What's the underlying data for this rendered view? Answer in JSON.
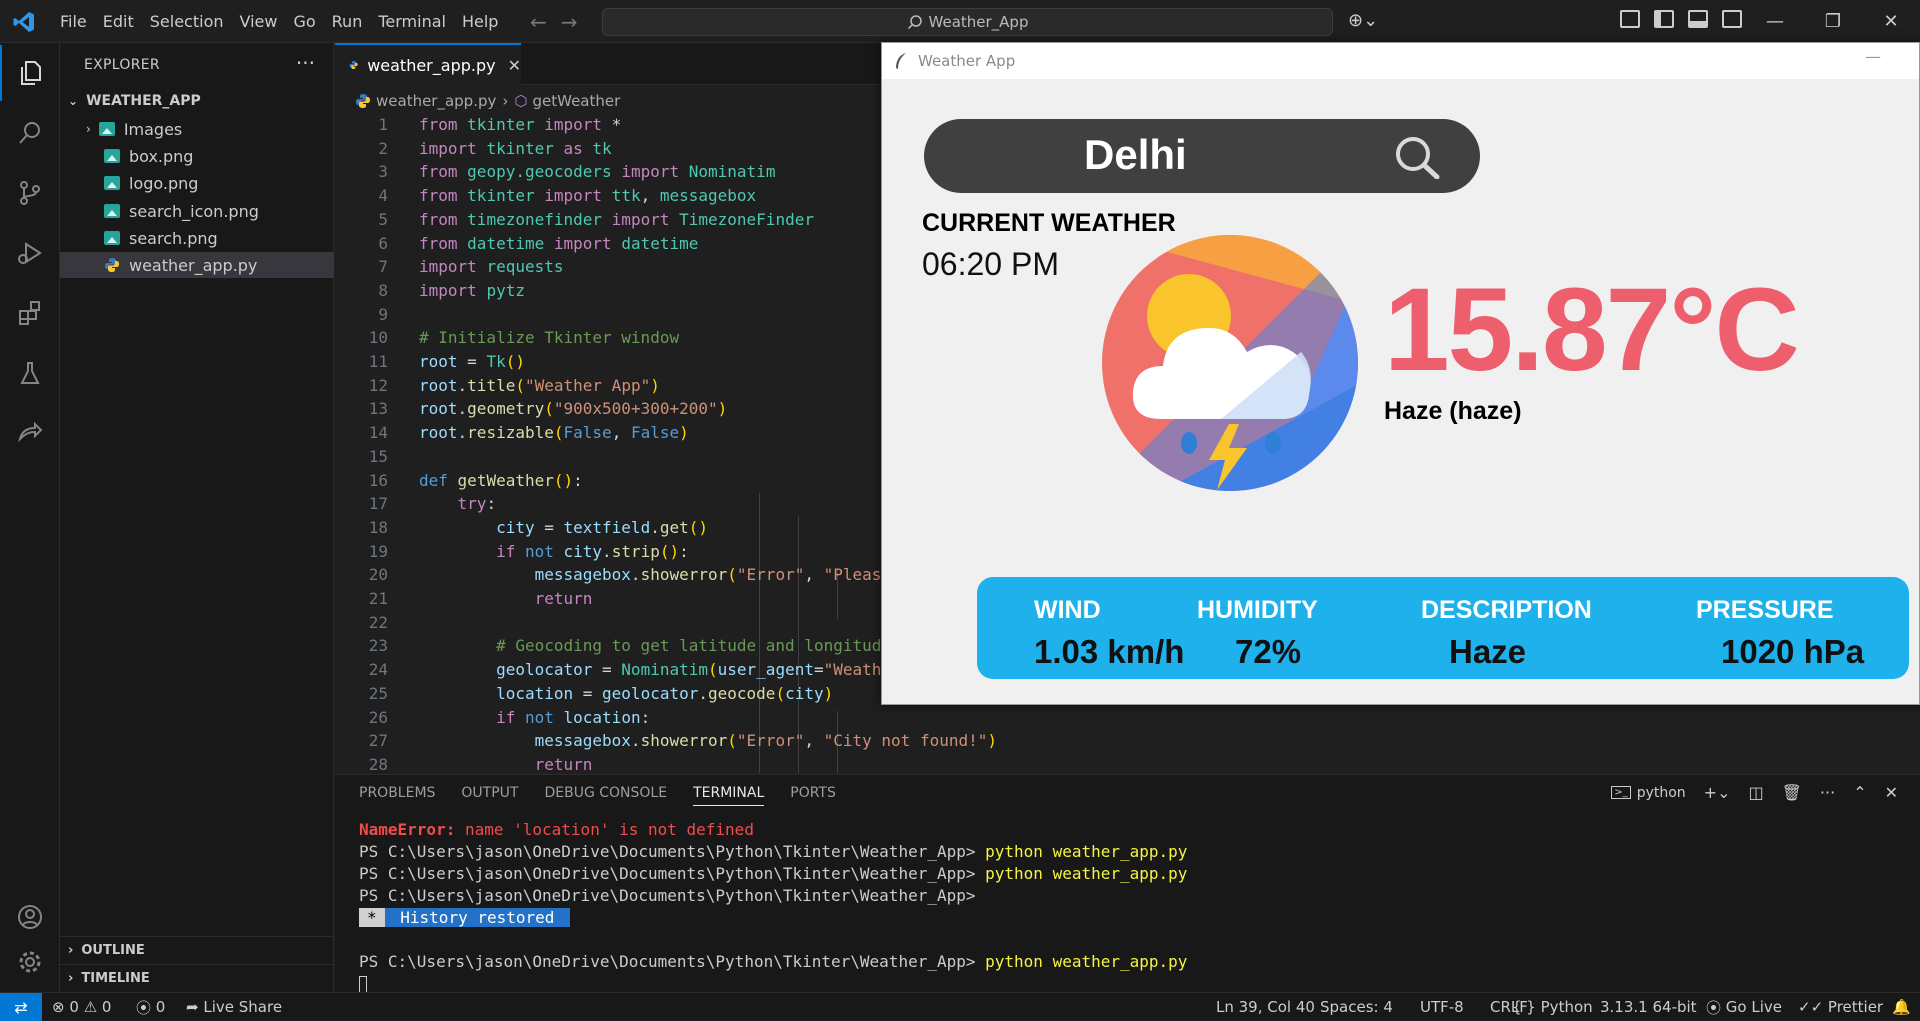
{
  "titlebar": {
    "menu": [
      "File",
      "Edit",
      "Selection",
      "View",
      "Go",
      "Run",
      "Terminal",
      "Help"
    ],
    "search": "Weather_App"
  },
  "sidebar": {
    "title": "EXPLORER",
    "folder": "WEATHER_APP",
    "items": [
      {
        "label": "Images",
        "type": "folder"
      },
      {
        "label": "box.png",
        "type": "image"
      },
      {
        "label": "logo.png",
        "type": "image"
      },
      {
        "label": "search_icon.png",
        "type": "image"
      },
      {
        "label": "search.png",
        "type": "image"
      },
      {
        "label": "weather_app.py",
        "type": "python",
        "selected": true
      }
    ],
    "outline": "OUTLINE",
    "timeline": "TIMELINE"
  },
  "editor": {
    "tab": "weather_app.py",
    "breadcrumb_file": "weather_app.py",
    "breadcrumb_symbol": "getWeather",
    "line_numbers": [
      "1",
      "2",
      "3",
      "4",
      "5",
      "6",
      "7",
      "8",
      "9",
      "10",
      "11",
      "12",
      "13",
      "14",
      "15",
      "16",
      "17",
      "18",
      "19",
      "20",
      "21",
      "22",
      "23",
      "24",
      "25",
      "26",
      "27",
      "28"
    ]
  },
  "panel": {
    "tabs": [
      "PROBLEMS",
      "OUTPUT",
      "DEBUG CONSOLE",
      "TERMINAL",
      "PORTS"
    ],
    "active_tab": "TERMINAL",
    "shell": "python",
    "terminal": {
      "error_name": "NameError:",
      "error_msg": " name 'location' is not defined",
      "prompt": "PS C:\\Users\\jason\\OneDrive\\Documents\\Python\\Tkinter\\Weather_App> ",
      "command": "python weather_app.py",
      "history": " History restored "
    }
  },
  "statusbar": {
    "errors": "0",
    "warnings": "0",
    "ports": "0",
    "live_share": "Live Share",
    "position": "Ln 39, Col 40",
    "spaces": "Spaces: 4",
    "encoding": "UTF-8",
    "eol": "CRLF",
    "language": "Python",
    "interpreter": "3.13.1 64-bit",
    "go_live": "Go Live",
    "prettier": "Prettier"
  },
  "weather_app": {
    "window_title": "Weather App",
    "city": "Delhi",
    "current_label": "CURRENT WEATHER",
    "time": "06:20 PM",
    "temperature": "15.87°C",
    "condition": "Haze (haze)",
    "labels": {
      "wind": "WIND",
      "humidity": "HUMIDITY",
      "description": "DESCRIPTION",
      "pressure": "PRESSURE"
    },
    "values": {
      "wind": "1.03 km/h",
      "humidity": "72%",
      "description": "Haze",
      "pressure": "1020 hPa"
    },
    "colors": {
      "temp": "#ee5f6d",
      "box": "#1eb1ec",
      "search": "#404040"
    }
  },
  "colors": {
    "accent": "#0078d4"
  }
}
